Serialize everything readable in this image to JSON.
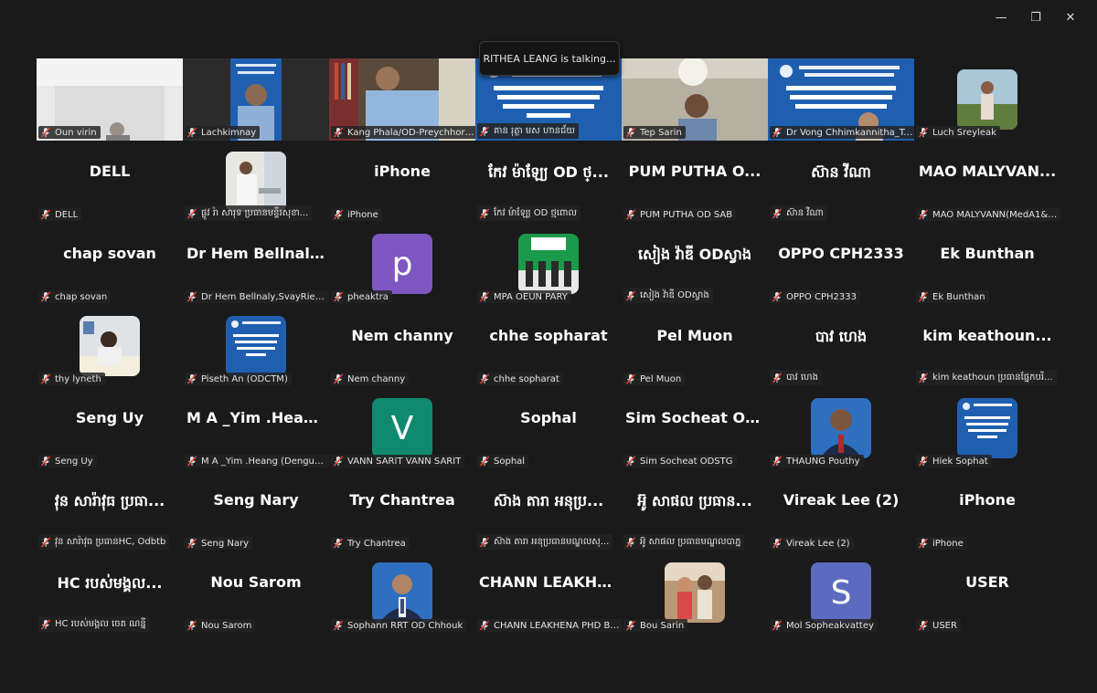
{
  "window": {
    "minimize": "—",
    "maximize": "❐",
    "close": "✕"
  },
  "talking_indicator": "RITHEA LEANG is talking...",
  "tiles": [
    {
      "kind": "video",
      "bg": "office",
      "name": "Oun virin"
    },
    {
      "kind": "video",
      "bg": "uniform_banner",
      "name": "Lachkimnay"
    },
    {
      "kind": "video",
      "bg": "uniform_shelf",
      "name": "Kang Phala/OD-Preychhor/PH..."
    },
    {
      "kind": "video",
      "bg": "banner",
      "name": "គាន រុត្ថា មស ហានជ័យ"
    },
    {
      "kind": "video",
      "bg": "man_room",
      "name": "Tep Sarin"
    },
    {
      "kind": "video",
      "bg": "banner_person",
      "name": "Dr Vong Chhimkannitha_Takr..."
    },
    {
      "kind": "avatar",
      "img": "woman_field",
      "name": "Luch Sreyleak"
    },
    {
      "kind": "text",
      "display": "DELL",
      "name": "DELL"
    },
    {
      "kind": "avatar",
      "img": "lab_man",
      "name": "ផ្លូវ រ៉ា សារុទ ប្រធានមន្ទីរសុខា..."
    },
    {
      "kind": "text",
      "display": "iPhone",
      "name": "iPhone"
    },
    {
      "kind": "text",
      "display": "កែវ ម៉ាឡែ្យ OD ថ្...",
      "name": "កែវ ម៉ាឡែ្យ OD ថ្មពោល"
    },
    {
      "kind": "text",
      "display": "PUM PUTHA O...",
      "name": "PUM PUTHA OD SAB"
    },
    {
      "kind": "text",
      "display": "ស៊ាន វីណា",
      "name": "ស៊ាន វីណា"
    },
    {
      "kind": "text",
      "display": "MAO MALYVAN...",
      "name": "MAO MALYVANN(MedA1&A6)"
    },
    {
      "kind": "text",
      "display": "chap sovan",
      "name": "chap sovan"
    },
    {
      "kind": "text",
      "display": "Dr Hem Bellnaly...",
      "name": "Dr Hem Bellnaly,SvayRieng Pr..."
    },
    {
      "kind": "letter",
      "letter": "p",
      "color": "#7e57c2",
      "name": "pheaktra"
    },
    {
      "kind": "avatar",
      "img": "ceremony",
      "name": "MPA OEUN PARY"
    },
    {
      "kind": "text",
      "display": "សៀង វ៉ាឌី ODស្វាង",
      "name": "សៀង វ៉ាឌី ODស្វាង"
    },
    {
      "kind": "text",
      "display": "OPPO CPH2333",
      "name": "OPPO CPH2333"
    },
    {
      "kind": "text",
      "display": "Ek Bunthan",
      "name": "Ek Bunthan"
    },
    {
      "kind": "avatar",
      "img": "woman_desk",
      "name": "thy lyneth"
    },
    {
      "kind": "avatar",
      "img": "banner_small",
      "name": "Piseth An (ODCTM)"
    },
    {
      "kind": "text",
      "display": "Nem channy",
      "name": "Nem channy"
    },
    {
      "kind": "text",
      "display": "chhe sopharat",
      "name": "chhe sopharat"
    },
    {
      "kind": "text",
      "display": "Pel Muon",
      "name": "Pel Muon"
    },
    {
      "kind": "text",
      "display": "បាវ ហេង",
      "name": "បាវ ហេង"
    },
    {
      "kind": "text",
      "display": "kim keathoun...",
      "name": "kim keathoun ប្រធានផ្នែកបរិ..."
    },
    {
      "kind": "text",
      "display": "Seng Uy",
      "name": "Seng Uy"
    },
    {
      "kind": "text",
      "display": "M A _Yim .Hean...",
      "name": "M A _Yim .Heang (Dengue Su..."
    },
    {
      "kind": "letter",
      "letter": "V",
      "color": "#0f8a6e",
      "name": "VANN SARIT VANN SARIT"
    },
    {
      "kind": "text",
      "display": "Sophal",
      "name": "Sophal"
    },
    {
      "kind": "text",
      "display": "Sim Socheat OD...",
      "name": "Sim Socheat ODSTG"
    },
    {
      "kind": "avatar",
      "img": "portrait_man",
      "name": "THAUNG Pouthy"
    },
    {
      "kind": "avatar",
      "img": "banner_small",
      "name": "Hiek Sophat"
    },
    {
      "kind": "text",
      "display": "វុន សារ៉ាវុធ ប្រធា...",
      "name": "វុន សារ៉ាវុធ ប្រធានHC, Odbtb"
    },
    {
      "kind": "text",
      "display": "Seng Nary",
      "name": "Seng Nary"
    },
    {
      "kind": "text",
      "display": "Try Chantrea",
      "name": "Try Chantrea"
    },
    {
      "kind": "text",
      "display": "ស៊ាង តារា អនុប្រ...",
      "name": "ស៊ាង តារា អនុប្រធានមណ្ឌលសុ..."
    },
    {
      "kind": "text",
      "display": "អ៊ូ សាផល ប្រធាន...",
      "name": "អ៊ូ សាផល ប្រធានមណ្ឌលបាភ្ន"
    },
    {
      "kind": "text",
      "display": "Vireak Lee (2)",
      "name": "Vireak Lee (2)"
    },
    {
      "kind": "text",
      "display": "iPhone",
      "name": "iPhone"
    },
    {
      "kind": "text",
      "display": "HC របស់មង្គល...",
      "name": "HC របស់មង្គល ចេត ណន្នី"
    },
    {
      "kind": "text",
      "display": "Nou Sarom",
      "name": "Nou Sarom"
    },
    {
      "kind": "avatar",
      "img": "portrait_suit",
      "name": "Sophann RRT OD Chhouk"
    },
    {
      "kind": "text",
      "display": "CHANN LEAKHE...",
      "name": "CHANN LEAKHENA PHD BTB"
    },
    {
      "kind": "avatar",
      "img": "couple",
      "name": "Bou Sarin"
    },
    {
      "kind": "letter",
      "letter": "S",
      "color": "#5c6bc0",
      "name": "Mol Sopheakvattey"
    },
    {
      "kind": "text",
      "display": "USER",
      "name": "USER"
    }
  ]
}
